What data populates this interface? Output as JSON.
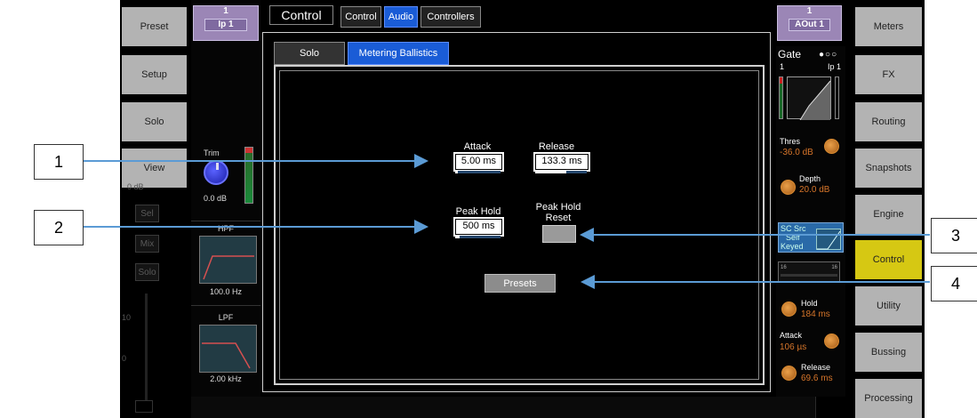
{
  "left_nav": [
    "Preset",
    "Setup",
    "Solo",
    "View"
  ],
  "left_ghost": {
    "db": "0 dB",
    "buttons": [
      "Sel",
      "Mix",
      "Solo"
    ],
    "scale": [
      "10",
      "0"
    ]
  },
  "input_channel": {
    "number": "1",
    "name": "Ip 1"
  },
  "trim": {
    "label": "Trim",
    "value": "0.0 dB"
  },
  "hpf": {
    "label": "HPF",
    "value": "100.0 Hz"
  },
  "lpf": {
    "label": "LPF",
    "value": "2.00 kHz"
  },
  "header": {
    "title": "Control",
    "tabs": [
      "Control",
      "Audio",
      "Controllers"
    ],
    "active_tab": "Audio"
  },
  "subtabs": [
    "Solo",
    "Metering Ballistics"
  ],
  "active_subtab": "Metering Ballistics",
  "fields": {
    "attack": {
      "label": "Attack",
      "value": "5.00 ms",
      "level": 0.05
    },
    "release": {
      "label": "Release",
      "value": "133.3 ms",
      "level": 0.6
    },
    "peak_hold": {
      "label": "Peak Hold",
      "value": "500 ms",
      "level": 0.1
    },
    "peak_hold_reset": {
      "label_line1": "Peak Hold",
      "label_line2": "Reset"
    }
  },
  "presets_button": "Presets",
  "output_channel": {
    "number": "1",
    "name": "AOut 1"
  },
  "gate": {
    "title": "Gate",
    "left": "1",
    "right": "Ip 1",
    "thres_label": "Thres",
    "thres_value": "-36.0 dB",
    "depth_label": "Depth",
    "depth_value": "20.0 dB",
    "sc_line1": "SC Src",
    "sc_line2": "Self",
    "sc_line3": "Keyed",
    "meter_left": "16",
    "meter_right": "16",
    "hold_label": "Hold",
    "hold_value": "184 ms",
    "attack_label": "Attack",
    "attack_value": "106 µs",
    "release_label": "Release",
    "release_value": "69.6 ms"
  },
  "right_nav": [
    "Meters",
    "FX",
    "Routing",
    "Snapshots",
    "Engine",
    "Control",
    "Utility",
    "Bussing",
    "Processing"
  ],
  "right_active": "Control",
  "callouts": [
    "1",
    "2",
    "3",
    "4"
  ],
  "colors": {
    "accent_blue": "#1a5cd6",
    "active_yellow": "#d6c813",
    "channel_purple": "#9b86b6",
    "annotation_arrow": "#5b9bd5",
    "gate_orange": "#d6752a"
  }
}
